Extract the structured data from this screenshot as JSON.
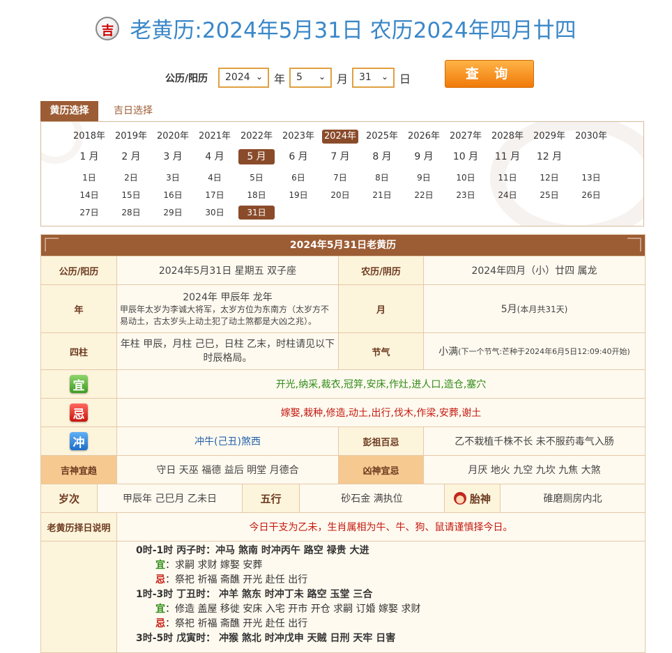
{
  "header": {
    "logo_char": "吉",
    "title": "老黄历:2024年5月31日 农历2024年四月廿四"
  },
  "query": {
    "label": "公历/阳历",
    "year": "2024",
    "month": "5",
    "day": "31",
    "year_unit": "年",
    "month_unit": "月",
    "day_unit": "日",
    "button": "查 询"
  },
  "tabs": {
    "active": "黄历选择",
    "other": "吉日选择"
  },
  "calendar": {
    "years": [
      "2018年",
      "2019年",
      "2020年",
      "2021年",
      "2022年",
      "2023年",
      "2024年",
      "2025年",
      "2026年",
      "2027年",
      "2028年",
      "2029年",
      "2030年"
    ],
    "selected_year": "2024年",
    "months": [
      "1 月",
      "2 月",
      "3 月",
      "4 月",
      "5 月",
      "6 月",
      "7 月",
      "8 月",
      "9 月",
      "10 月",
      "11 月",
      "12 月"
    ],
    "selected_month": "5 月",
    "days": [
      "1日",
      "2日",
      "3日",
      "4日",
      "5日",
      "6日",
      "7日",
      "8日",
      "9日",
      "10日",
      "11日",
      "12日",
      "13日",
      "14日",
      "15日",
      "16日",
      "17日",
      "18日",
      "19日",
      "20日",
      "21日",
      "22日",
      "23日",
      "24日",
      "25日",
      "26日",
      "27日",
      "28日",
      "29日",
      "30日",
      "31日"
    ],
    "selected_day": "31日"
  },
  "almanac": {
    "heading": "2024年5月31日老黄历",
    "gregorian_label": "公历/阳历",
    "gregorian_value": "2024年5月31日 星期五 双子座",
    "lunar_label": "农历/阴历",
    "lunar_value": "2024年四月（小）廿四 属龙",
    "year_label": "年",
    "year_main": "2024年 甲辰年 龙年",
    "year_note": "甲辰年太岁为李诚大将军，太岁方位为东南方（太岁方不易动土，古太岁头上动土犯了动土煞都是大凶之兆）。",
    "month_label": "月",
    "month_main": "5月",
    "month_note": "(本月共31天)",
    "pillars_label": "四柱",
    "pillars_value": "年柱 甲辰，月柱 己巳，日柱 乙末，时柱请见以下时辰格局。",
    "solar_term_label": "节气",
    "solar_term_main": "小满",
    "solar_term_note": "(下一个节气:芒种于2024年6月5日12:09:40开始)",
    "yi_icon": "宜",
    "yi_value": "开光,纳采,裁衣,冠笄,安床,作灶,进人口,造仓,塞穴",
    "ji_icon": "忌",
    "ji_value": "嫁娶,栽种,修造,动土,出行,伐木,作梁,安葬,谢土",
    "chong_icon": "冲",
    "chong_value": "冲牛(己丑)煞西",
    "pengzu_label": "彭祖百忌",
    "pengzu_value": "乙不栽植千株不长 未不服药毒气入肠",
    "jishen_label": "吉神宜趋",
    "jishen_value": "守日 天巫 福德 益后 明堂 月德合",
    "xiongshen_label": "凶神宜忌",
    "xiongshen_value": "月厌 地火 九空 九坎 九焦 大煞",
    "suici_label": "岁次",
    "suici_value": "甲辰年 己巳月 乙未日",
    "wuxing_label": "五行",
    "wuxing_value": "砂石金 满执位",
    "taishen_label": "胎神",
    "taishen_value": "碓磨厕房内北",
    "explain_label": "老黄历择日说明",
    "explain_value": "今日干支为乙未，生肖属相为牛、牛、狗、鼠请谨慎择今日。",
    "hours": [
      {
        "head": "0时-1时 丙子时：冲马 煞南 时冲丙午 路空 禄贵 大进",
        "yi_mark": "宜",
        "yi": "：求嗣 求财 嫁娶 安葬",
        "ji_mark": "忌",
        "ji": "：祭祀 祈福 斋醮 开光 赴任 出行"
      },
      {
        "head": "1时-3时 丁丑时： 冲羊 煞东 时冲丁未 路空 玉堂 三合",
        "yi_mark": "宜",
        "yi": "：修造 盖屋 移徙 安床 入宅 开市 开仓 求嗣 订婚 嫁娶 求财",
        "ji_mark": "忌",
        "ji": "：祭祀 祈福 斋醮 开光 赴任 出行"
      },
      {
        "head": "3时-5时 戊寅时： 冲猴 煞北 时冲戊申 天贼 日刑 天牢 日害"
      }
    ]
  },
  "colors": {
    "accent": "#9c5c34",
    "title_blue": "#3a87c8",
    "button_orange": "#f07a0a",
    "yi_green": "#2e8b16",
    "ji_red": "#c4190f"
  }
}
